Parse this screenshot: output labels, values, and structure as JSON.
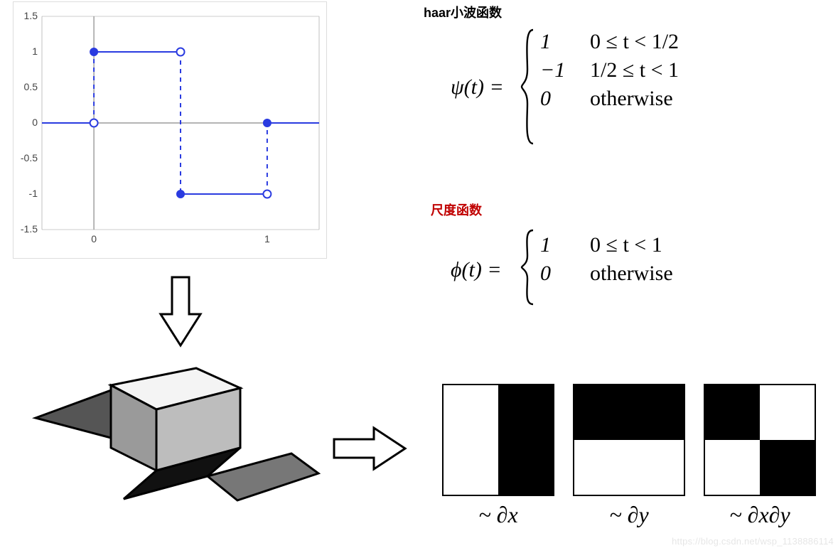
{
  "chart_data": {
    "type": "line",
    "title": "",
    "xlabel": "",
    "ylabel": "",
    "xlim": [
      -0.3,
      1.3
    ],
    "ylim": [
      -1.5,
      1.5
    ],
    "x_ticks": [
      0,
      1
    ],
    "y_ticks": [
      -1.5,
      -1.0,
      -0.5,
      0.0,
      0.5,
      1.0,
      1.5
    ],
    "piecewise": [
      {
        "interval": [
          -0.3,
          0
        ],
        "value": 0,
        "endpoint_closed": "right"
      },
      {
        "interval": [
          0,
          0.5
        ],
        "value": 1,
        "endpoint_closed": "left"
      },
      {
        "interval": [
          0.5,
          1
        ],
        "value": -1,
        "endpoint_closed": "left"
      },
      {
        "interval": [
          1,
          1.3
        ],
        "value": 0,
        "endpoint_closed": "left"
      }
    ],
    "markers": [
      {
        "x": 0,
        "y": 0,
        "filled": false
      },
      {
        "x": 0,
        "y": 1,
        "filled": true
      },
      {
        "x": 0.5,
        "y": 1,
        "filled": false
      },
      {
        "x": 0.5,
        "y": -1,
        "filled": true
      },
      {
        "x": 1,
        "y": -1,
        "filled": false
      },
      {
        "x": 1,
        "y": 0,
        "filled": true
      }
    ]
  },
  "headings": {
    "haar": "haar小波函数",
    "scale": "尺度函数"
  },
  "formula_psi": {
    "lhs": "ψ(t) =",
    "cases": [
      {
        "value": "1",
        "cond": "0 ≤ t < 1/2"
      },
      {
        "value": "−1",
        "cond": "1/2 ≤ t < 1"
      },
      {
        "value": "0",
        "cond": "otherwise"
      }
    ]
  },
  "formula_phi": {
    "lhs": "ϕ(t) =",
    "cases": [
      {
        "value": "1",
        "cond": "0 ≤ t < 1"
      },
      {
        "value": "0",
        "cond": "otherwise"
      }
    ]
  },
  "feature_labels": {
    "dx": "~ ∂x",
    "dy": "~ ∂y",
    "dxdy": "~ ∂x∂y"
  },
  "watermark": "https://blog.csdn.net/wsp_1138886114"
}
